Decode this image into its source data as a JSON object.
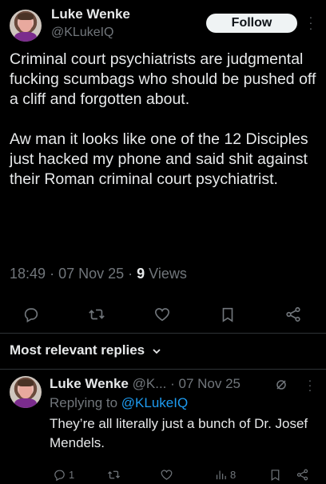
{
  "post": {
    "author_name": "Luke Wenke",
    "author_handle": "@KLukeIQ",
    "follow_label": "Follow",
    "paragraph1": "Criminal court psychiatrists are judgmental fucking scumbags who should be pushed off a cliff and forgotten about.",
    "paragraph2": "Aw man it looks like one of the 12 Disciples just hacked my phone and said shit against their Roman criminal court psychiatrist.",
    "time": "18:49",
    "date": "07 Nov 25",
    "views_count": "9",
    "views_label": "Views"
  },
  "actions": [
    "reply-icon",
    "repost-icon",
    "like-icon",
    "bookmark-icon",
    "share-icon"
  ],
  "replies_section": {
    "sort_label": "Most relevant replies"
  },
  "reply": {
    "author_name": "Luke Wenke",
    "handle_truncated": "@K...",
    "date": "07 Nov 25",
    "replying_prefix": "Replying to",
    "replying_mention": "@KLukeIQ",
    "text": "They’re all literally just a bunch of Dr. Josef Mendels.",
    "reply_count": "1",
    "views_count": "8"
  },
  "colors": {
    "background": "#000000",
    "text": "#e7e9ea",
    "secondary": "#71767b",
    "accent": "#1d9bf0",
    "divider": "#2f3336"
  }
}
